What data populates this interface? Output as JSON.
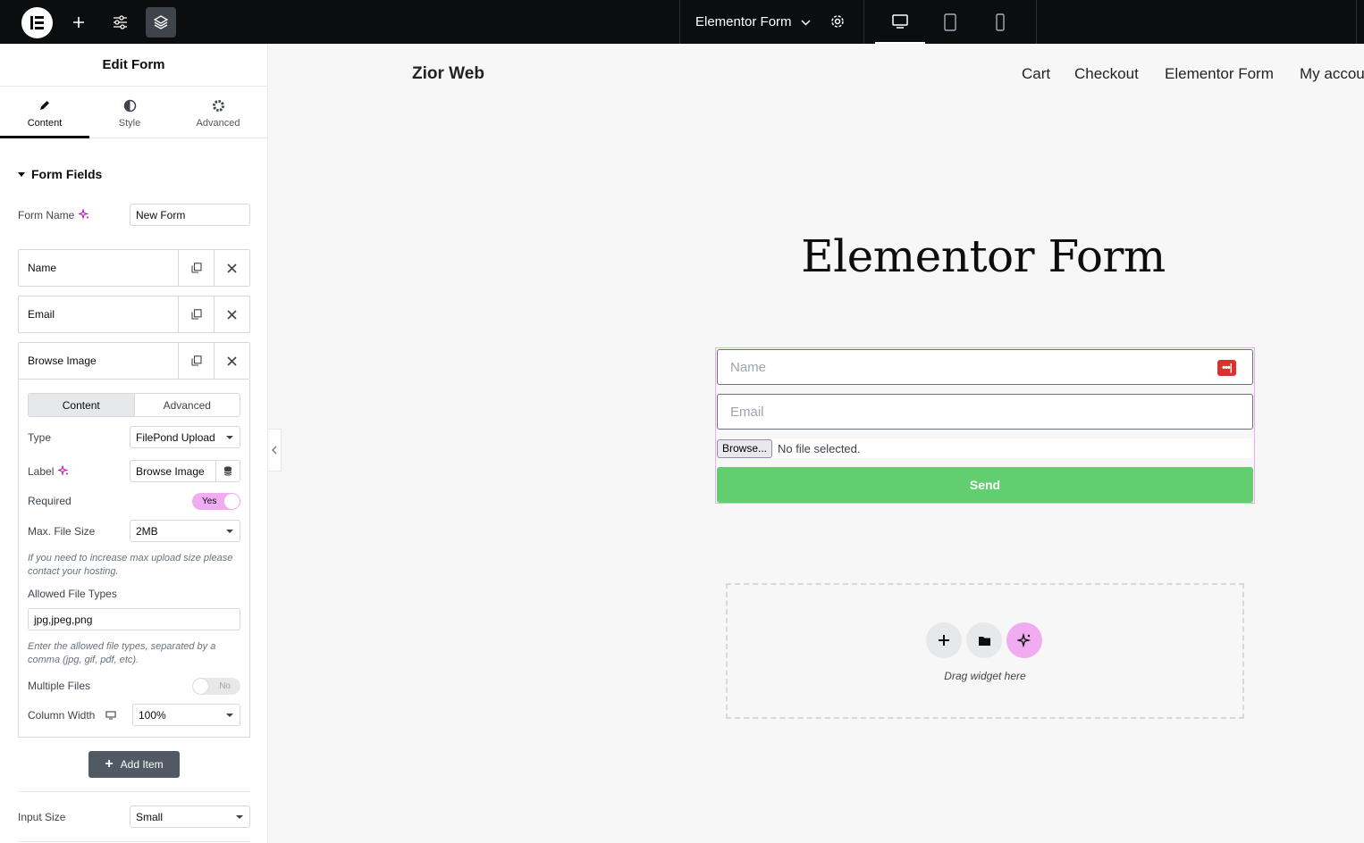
{
  "topbar": {
    "document_title": "Elementor Form",
    "icons": [
      "elementor-logo-icon",
      "add-icon",
      "site-settings-icon",
      "structure-icon",
      "page-settings-gear-icon",
      "desktop-icon",
      "tablet-icon",
      "mobile-icon"
    ]
  },
  "panel": {
    "title": "Edit Form",
    "tabs": [
      {
        "label": "Content",
        "icon": "pencil-icon",
        "active": true
      },
      {
        "label": "Style",
        "icon": "half-circle-icon",
        "active": false
      },
      {
        "label": "Advanced",
        "icon": "gear-icon",
        "active": false
      }
    ],
    "section_title": "Form Fields",
    "form_name_label": "Form Name",
    "form_name_value": "New Form",
    "fields": [
      {
        "label": "Name"
      },
      {
        "label": "Email"
      },
      {
        "label": "Browse Image"
      }
    ],
    "field_editor": {
      "tabs": [
        "Content",
        "Advanced"
      ],
      "type_label": "Type",
      "type_value": "FilePond Upload",
      "label_label": "Label",
      "label_value": "Browse Image",
      "required_label": "Required",
      "required_value": "Yes",
      "max_size_label": "Max. File Size",
      "max_size_value": "2MB",
      "max_size_note": "If you need to increase max upload size please contact your hosting.",
      "allowed_types_label": "Allowed File Types",
      "allowed_types_value": "jpg,jpeg,png",
      "allowed_types_note": "Enter the allowed file types, separated by a comma (jpg, gif, pdf, etc).",
      "multiple_label": "Multiple Files",
      "multiple_value": "No",
      "column_width_label": "Column Width",
      "column_width_value": "100%"
    },
    "add_item_label": "Add Item",
    "input_size_label": "Input Size",
    "input_size_value": "Small"
  },
  "canvas": {
    "site_title": "Zior Web",
    "nav": [
      "Cart",
      "Checkout",
      "Elementor Form",
      "My account"
    ],
    "heading": "Elementor Form",
    "form": {
      "name_placeholder": "Name",
      "email_placeholder": "Email",
      "browse_label": "Browse...",
      "file_status": "No file selected.",
      "send_label": "Send"
    },
    "drop_zone_text": "Drag widget here"
  },
  "colors": {
    "topbar_bg": "#0c0d0e",
    "accent_pink": "#f0abf1",
    "send_green": "#61ce70",
    "password_badge_red": "#d9322f"
  }
}
